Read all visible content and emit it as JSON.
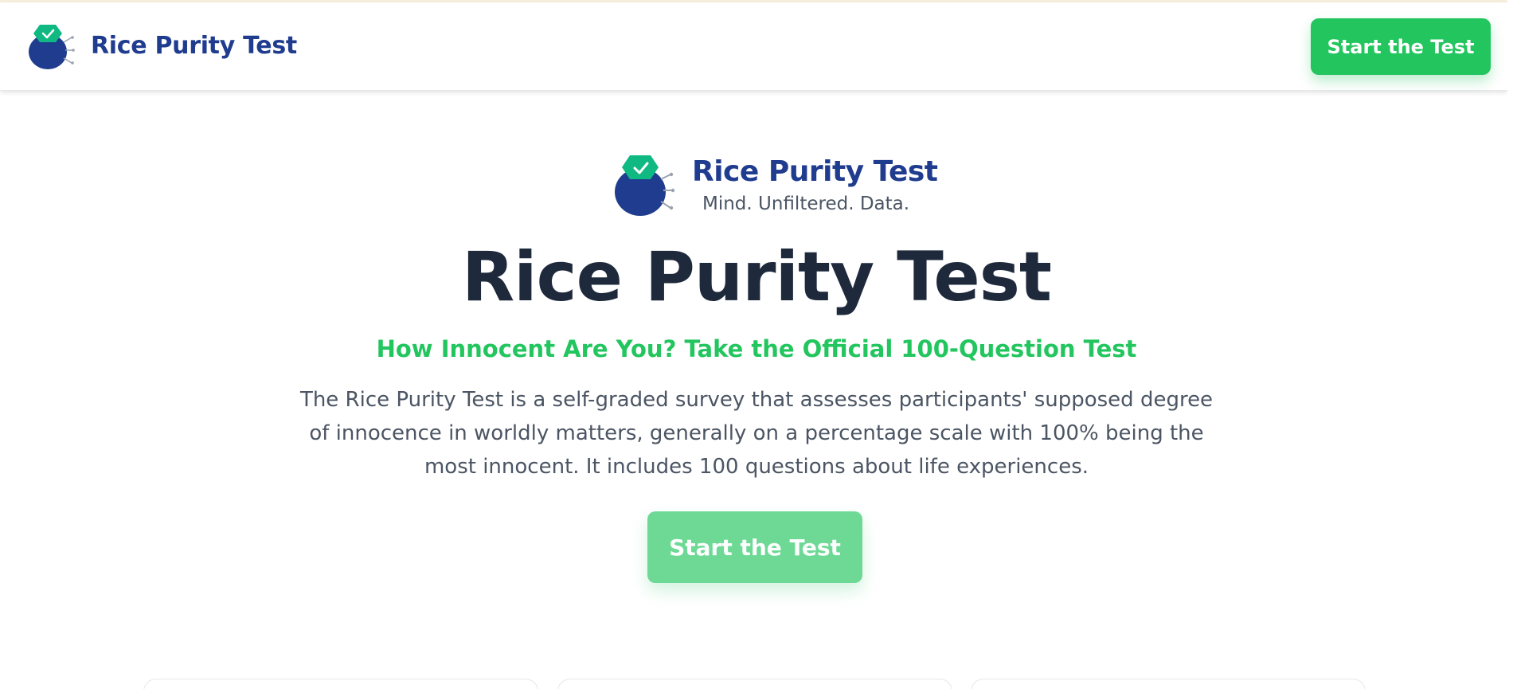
{
  "nav": {
    "brand_title": "Rice Purity Test",
    "cta_label": "Start the Test"
  },
  "hero": {
    "brand_name": "Rice Purity Test",
    "brand_tagline": "Mind. Unfiltered. Data.",
    "title": "Rice Purity Test",
    "subtitle": "How Innocent Are You? Take the Official 100-Question Test",
    "description": "The Rice Purity Test is a self-graded survey that assesses participants' supposed degree of innocence in worldly matters, generally on a percentage scale with 100% being the most innocent. It includes 100 questions about life experiences.",
    "cta_label": "Start the Test"
  },
  "icons": {
    "logo": "rice-purity-logo-icon",
    "logo_badge": "check-icon"
  },
  "colors": {
    "brand_navy": "#1f3c8f",
    "accent_green": "#22c55e",
    "cta_faded": "#6dd995",
    "badge_teal": "#10b981",
    "title_dark": "#1e293b",
    "body_gray": "#4b5563"
  }
}
